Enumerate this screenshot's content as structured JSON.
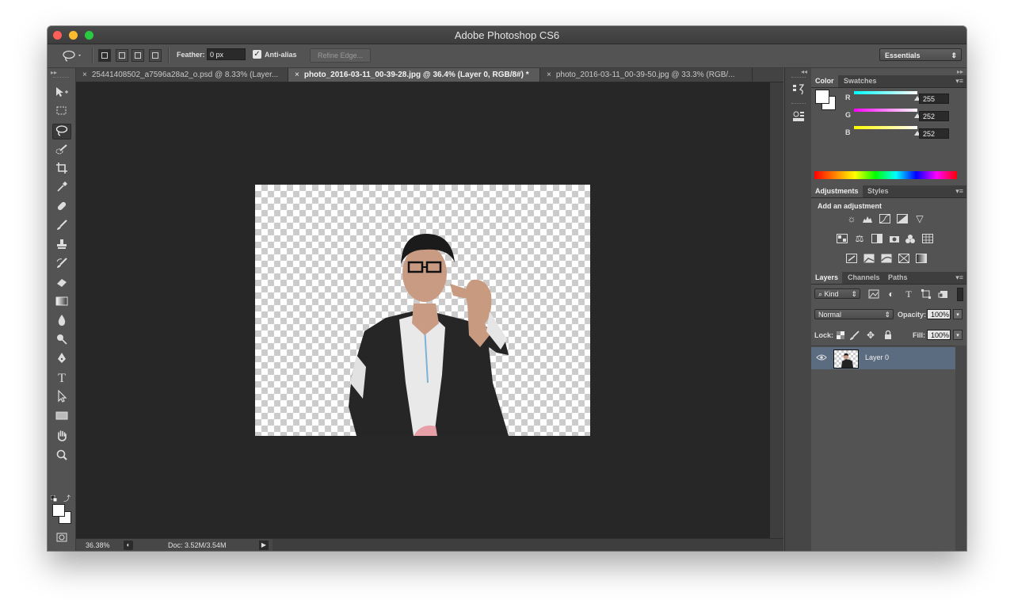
{
  "window": {
    "title": "Adobe Photoshop CS6"
  },
  "options_bar": {
    "feather_label": "Feather:",
    "feather_value": "0 px",
    "anti_alias_label": "Anti-alias",
    "anti_alias_checked": true,
    "refine_edge_label": "Refine Edge...",
    "workspace_label": "Essentials"
  },
  "tabs": [
    {
      "label": "25441408502_a7596a28a2_o.psd @ 8.33% (Layer...",
      "close": "×",
      "active": false
    },
    {
      "label": "photo_2016-03-11_00-39-28.jpg @ 36.4% (Layer 0, RGB/8#) *",
      "close": "×",
      "active": true
    },
    {
      "label": "photo_2016-03-11_00-39-50.jpg @ 33.3% (RGB/...",
      "close": "×",
      "active": false
    }
  ],
  "status_bar": {
    "zoom": "36.38%",
    "doc_info": "Doc: 3.52M/3.54M"
  },
  "color_panel": {
    "tabs": [
      "Color",
      "Swatches"
    ],
    "r_label": "R",
    "g_label": "G",
    "b_label": "B",
    "r_value": "255",
    "g_value": "252",
    "b_value": "252"
  },
  "adjustments_panel": {
    "tabs": [
      "Adjustments",
      "Styles"
    ],
    "heading": "Add an adjustment"
  },
  "layers_panel": {
    "tabs": [
      "Layers",
      "Channels",
      "Paths"
    ],
    "filter_label": "Kind",
    "blend_mode": "Normal",
    "opacity_label": "Opacity:",
    "opacity_value": "100%",
    "lock_label": "Lock:",
    "fill_label": "Fill:",
    "fill_value": "100%",
    "layers": [
      {
        "name": "Layer 0",
        "visible": true,
        "selected": true
      }
    ]
  },
  "colors": {
    "accent_selected_layer": "#5b6b80",
    "canvas_bg": "#272727",
    "ui_bg": "#535353"
  }
}
